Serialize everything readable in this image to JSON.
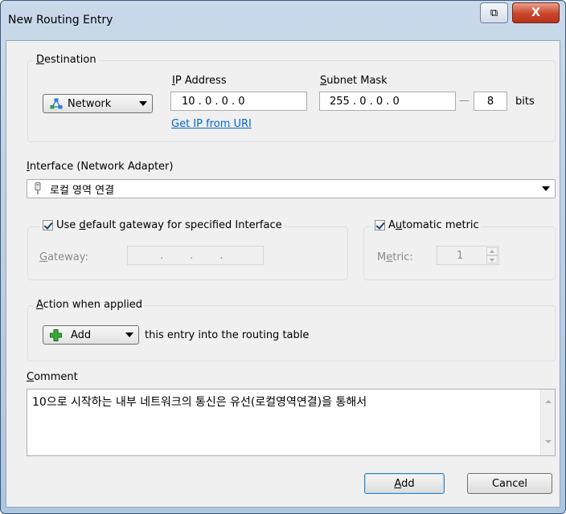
{
  "window": {
    "title": "New Routing Entry",
    "restore_glyph": "⧉",
    "close_glyph": "X"
  },
  "destination": {
    "legend_pre": "",
    "legend_u": "D",
    "legend_post": "estination",
    "type_value": "Network",
    "ip_label_pre": "",
    "ip_label_u": "I",
    "ip_label_post": "P Address",
    "ip_value": "10 . 0 . 0 . 0",
    "get_ip_link": "Get IP from URI",
    "mask_label_pre": "",
    "mask_label_u": "S",
    "mask_label_post": "ubnet Mask",
    "mask_value": "255 . 0 . 0 . 0",
    "bits_value": "8",
    "bits_label": "bits",
    "dash": "—"
  },
  "interface": {
    "label_pre": "",
    "label_u": "I",
    "label_post": "nterface (Network Adapter)",
    "value": "로컬 영역 연결"
  },
  "gateway": {
    "checkbox_pre": "Use ",
    "checkbox_u": "d",
    "checkbox_post": "efault gateway for specified Interface",
    "label_pre": "",
    "label_u": "G",
    "label_post": "ateway:",
    "value": ".        .        ."
  },
  "metric": {
    "checkbox_pre": "A",
    "checkbox_u": "u",
    "checkbox_post": "tomatic metric",
    "label_pre": "M",
    "label_u": "e",
    "label_post": "tric:",
    "value": "1"
  },
  "action": {
    "legend_pre": "",
    "legend_u": "A",
    "legend_post": "ction when applied",
    "value": "Add",
    "suffix": "this entry into the routing table"
  },
  "comment": {
    "label_pre": "",
    "label_u": "C",
    "label_post": "omment",
    "value": "10으로 시작하는 내부 네트워크의 통신은 유선(로컬영역연결)을 통해서"
  },
  "buttons": {
    "add_u": "A",
    "add_post": "dd",
    "cancel": "Cancel"
  }
}
